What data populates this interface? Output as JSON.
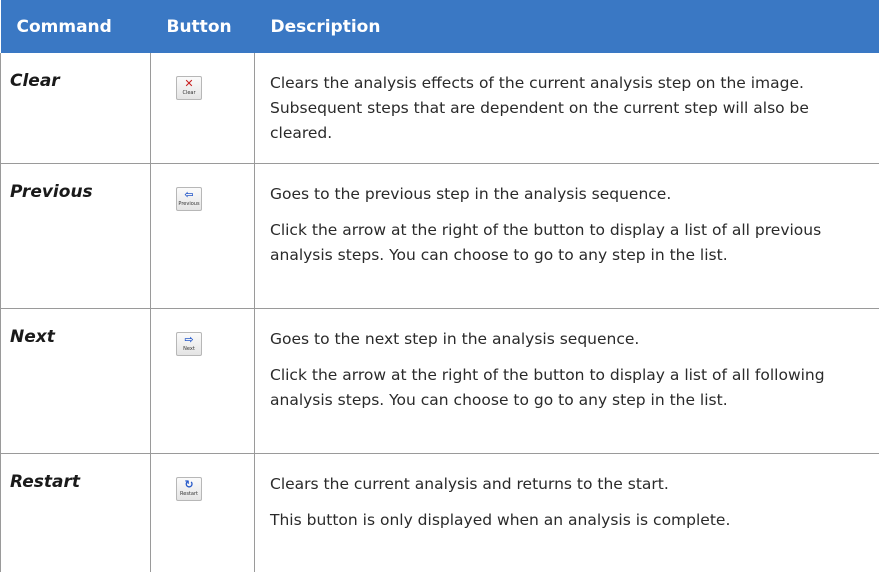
{
  "header": {
    "command": "Command",
    "button": "Button",
    "description": "Description"
  },
  "rows": [
    {
      "command": "Clear",
      "button_label": "Clear",
      "icon": "x-icon",
      "paragraphs": [
        "Clears the analysis effects of the current analysis step on the image. Subsequent steps that are dependent on the current step will also be cleared."
      ]
    },
    {
      "command": "Previous",
      "button_label": "Previous",
      "icon": "arrow-left-icon",
      "paragraphs": [
        "Goes to the previous step in the analysis sequence.",
        "Click the arrow at the right of the button to display a list of all previous analysis steps. You can choose to go to any step in the list."
      ]
    },
    {
      "command": "Next",
      "button_label": "Next",
      "icon": "arrow-right-icon",
      "paragraphs": [
        "Goes to the next step in the analysis sequence.",
        "Click the arrow at the right of the button to display a list of all following analysis steps. You can choose to go to any step in the list."
      ]
    },
    {
      "command": "Restart",
      "button_label": "Restart",
      "icon": "restart-icon",
      "paragraphs": [
        "Clears the current analysis and returns to the start.",
        "This button is only displayed when an analysis is complete."
      ]
    }
  ],
  "colors": {
    "header_bg": "#3a78c4",
    "header_text": "#ffffff",
    "border": "#9a9a9a"
  }
}
